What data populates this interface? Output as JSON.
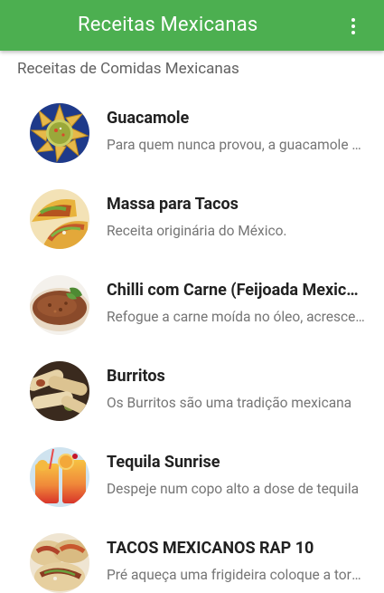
{
  "app_bar": {
    "title": "Receitas Mexicanas",
    "overflow_icon": "more-vert-icon",
    "color": "#4CAF50"
  },
  "section": {
    "header": "Receitas de Comidas Mexicanas"
  },
  "recipes": [
    {
      "title": "Guacamole",
      "description": "Para quem nunca provou, a guacamole é um creme de abacate",
      "image": "guacamole-image"
    },
    {
      "title": "Massa para Tacos",
      "description": "Receita originária do México.",
      "image": "tacos-image"
    },
    {
      "title": "Chilli com Carne (Feijoada Mexicana)",
      "description": "Refogue a carne moída no óleo, acrescente a cebola",
      "image": "chilli-image"
    },
    {
      "title": "Burritos",
      "description": "Os Burritos são uma tradição mexicana",
      "image": "burritos-image"
    },
    {
      "title": "Tequila Sunrise",
      "description": "Despeje num copo alto a dose de tequila",
      "image": "tequila-image"
    },
    {
      "title": "TACOS MEXICANOS RAP 10",
      "description": "Pré aqueça uma frigideira coloque a tortilha",
      "image": "tacos-rap10-image"
    }
  ]
}
